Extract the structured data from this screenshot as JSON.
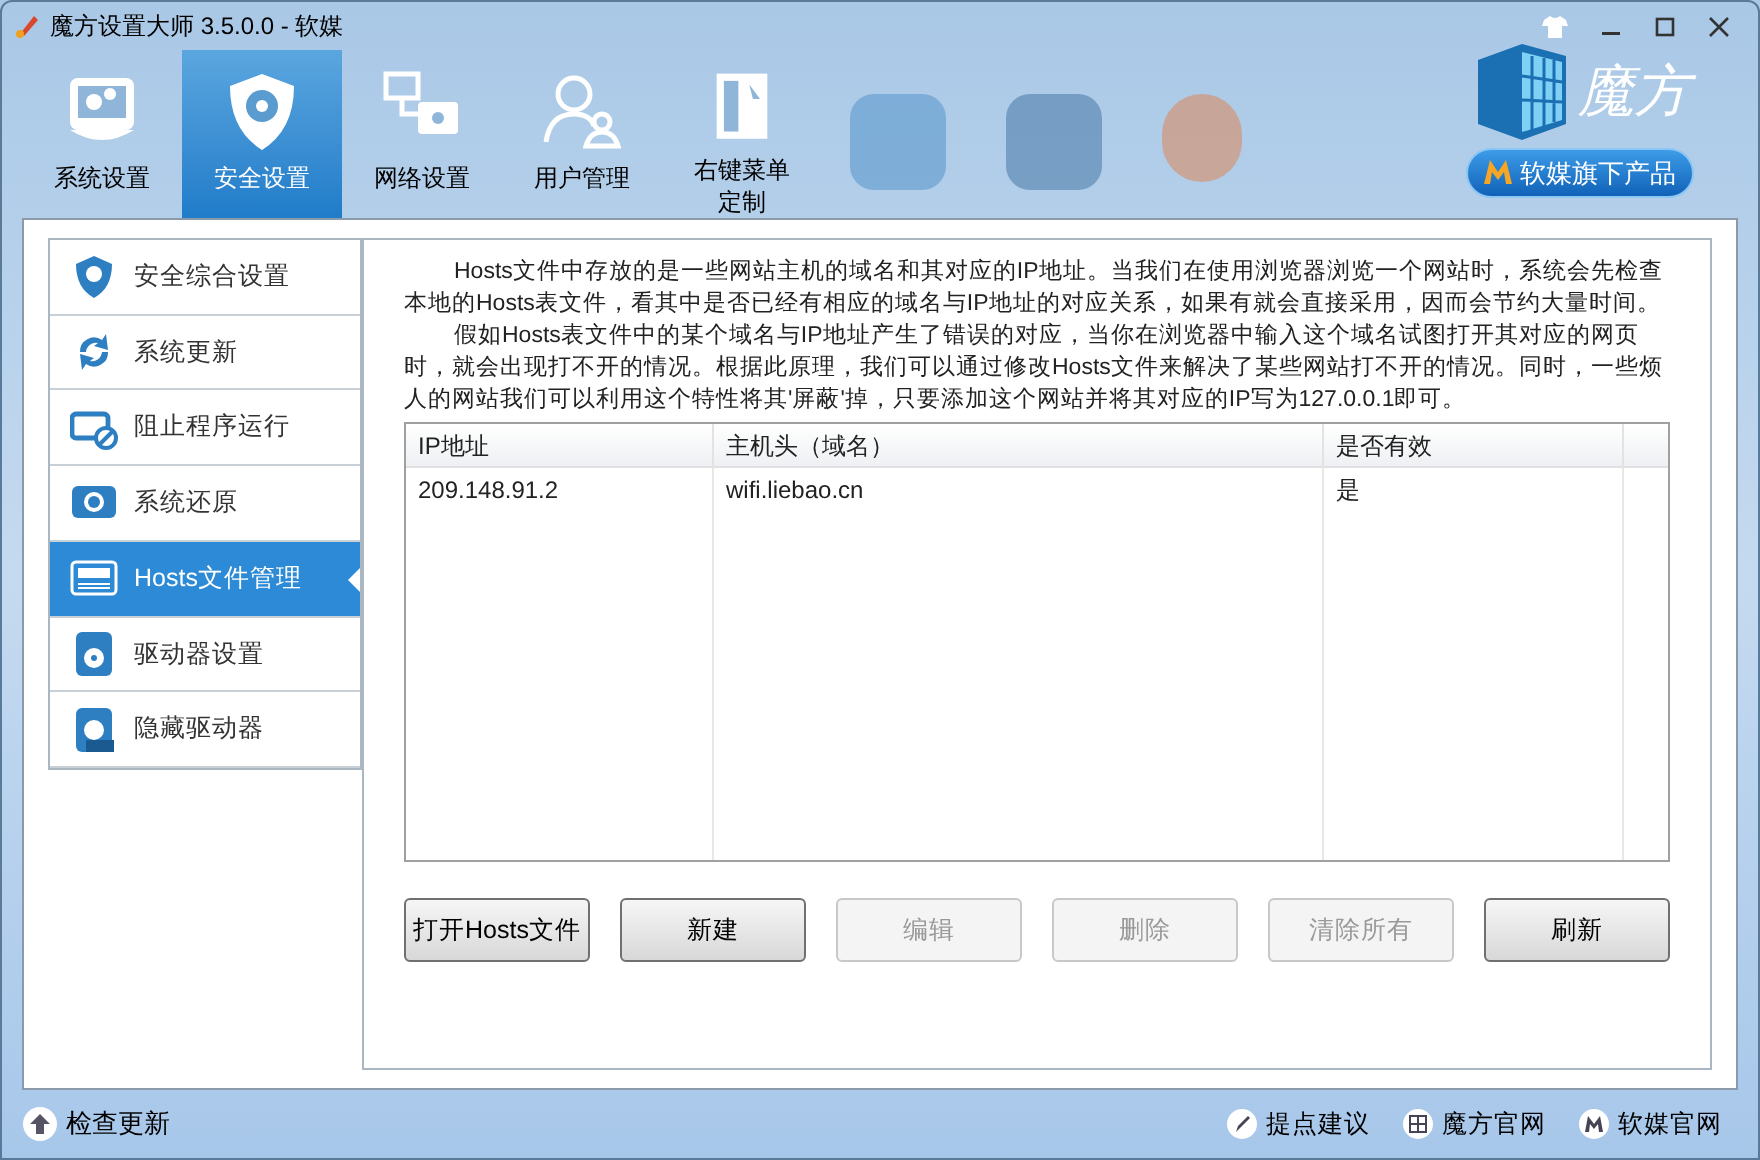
{
  "window": {
    "title": "魔方设置大师 3.5.0.0 - 软媒"
  },
  "tabs": [
    {
      "label": "系统设置",
      "selected": false,
      "kind": "gear-screen"
    },
    {
      "label": "安全设置",
      "selected": true,
      "kind": "shield"
    },
    {
      "label": "网络设置",
      "selected": false,
      "kind": "network"
    },
    {
      "label": "用户管理",
      "selected": false,
      "kind": "users"
    },
    {
      "label": "右键菜单定制",
      "selected": false,
      "kind": "menu"
    }
  ],
  "brand": {
    "name": "魔方",
    "badge": "软媒旗下产品"
  },
  "sidebar": {
    "items": [
      {
        "label": "安全综合设置",
        "selected": false,
        "kind": "shield"
      },
      {
        "label": "系统更新",
        "selected": false,
        "kind": "refresh"
      },
      {
        "label": "阻止程序运行",
        "selected": false,
        "kind": "block"
      },
      {
        "label": "系统还原",
        "selected": false,
        "kind": "restore"
      },
      {
        "label": "Hosts文件管理",
        "selected": true,
        "kind": "hosts"
      },
      {
        "label": "驱动器设置",
        "selected": false,
        "kind": "drive"
      },
      {
        "label": "隐藏驱动器",
        "selected": false,
        "kind": "hide"
      }
    ]
  },
  "description": [
    "Hosts文件中存放的是一些网站主机的域名和其对应的IP地址。当我们在使用浏览器浏览一个网站时，系统会先检查本地的Hosts表文件，看其中是否已经有相应的域名与IP地址的对应关系，如果有就会直接采用，因而会节约大量时间。",
    "假如Hosts表文件中的某个域名与IP地址产生了错误的对应，当你在浏览器中输入这个域名试图打开其对应的网页时，就会出现打不开的情况。根据此原理，我们可以通过修改Hosts文件来解决了某些网站打不开的情况。同时，一些烦人的网站我们可以利用这个特性将其'屏蔽'掉，只要添加这个网站并将其对应的IP写为127.0.0.1即可。"
  ],
  "table": {
    "columns": [
      "IP地址",
      "主机头（域名）",
      "是否有效"
    ],
    "rows": [
      [
        "209.148.91.2",
        "wifi.liebao.cn",
        "是"
      ]
    ]
  },
  "buttons": [
    {
      "label": "打开Hosts文件",
      "disabled": false
    },
    {
      "label": "新建",
      "disabled": false
    },
    {
      "label": "编辑",
      "disabled": true
    },
    {
      "label": "删除",
      "disabled": true
    },
    {
      "label": "清除所有",
      "disabled": true
    },
    {
      "label": "刷新",
      "disabled": false
    }
  ],
  "status_bar": {
    "left": "检查更新",
    "links": [
      {
        "label": "提点建议",
        "kind": "pen"
      },
      {
        "label": "魔方官网",
        "kind": "cube"
      },
      {
        "label": "软媒官网",
        "kind": "m"
      }
    ]
  }
}
